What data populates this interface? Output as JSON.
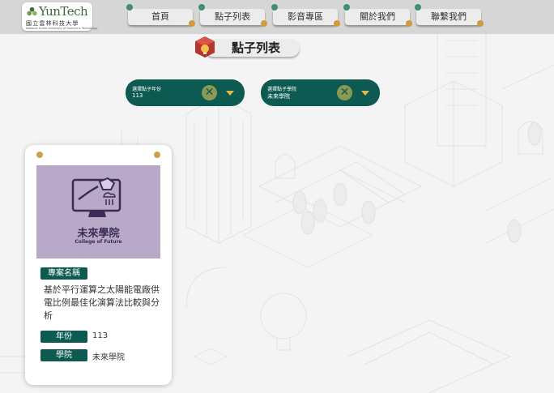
{
  "header": {
    "logo": {
      "brand": "YunTech",
      "name_cn": "國立雲林科技大學",
      "name_en": "National Yunlin University of Science & Technology"
    },
    "nav": [
      {
        "label": "首頁"
      },
      {
        "label": "點子列表"
      },
      {
        "label": "影音專區"
      },
      {
        "label": "關於我們"
      },
      {
        "label": "聯繫我們"
      }
    ]
  },
  "page": {
    "title": "點子列表",
    "title_icon": "lightbulb-box-icon"
  },
  "filters": {
    "year": {
      "label": "選擇點子年份",
      "value": "113"
    },
    "college": {
      "label": "選擇點子學院",
      "value": "未來學院"
    }
  },
  "card": {
    "image": {
      "college_cn": "未來學院",
      "college_en": "College of Future"
    },
    "project_label": "專案名稱",
    "project_name": "基於平行運算之太陽能電廠供電比例最佳化演算法比較與分析",
    "year_label": "年份",
    "year_value": "113",
    "college_label": "學院",
    "college_value": "未來學院"
  },
  "colors": {
    "accent": "#0c5a52",
    "dot_green": "#3e8e78",
    "dot_gold": "#d19a3a",
    "olive": "#8a9a55",
    "card_purple": "#b8a9c9"
  }
}
